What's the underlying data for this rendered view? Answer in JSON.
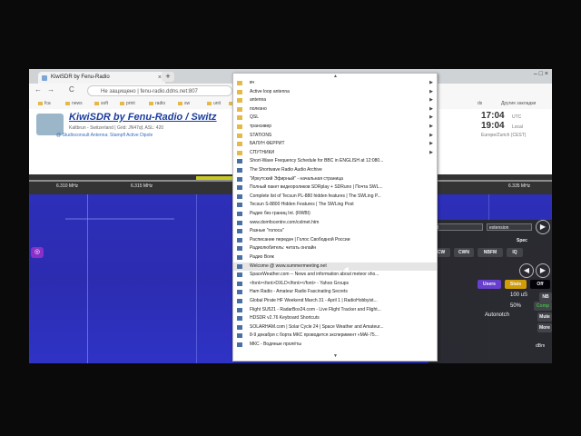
{
  "browser": {
    "tab_title": "KiwiSDR by Fenu-Radio",
    "tab_close": "×",
    "new_tab": "+",
    "window_controls": "–  □  ×",
    "nav": {
      "back": "←",
      "forward": "→",
      "reload": "C",
      "info": "ⓘ"
    },
    "url_security": "Не защищено",
    "url": "fenu-radio.ddns.net:807",
    "bookmarks": [
      "fca",
      "news",
      "soft",
      "print",
      "radio",
      "sw",
      "unit",
      "Sm"
    ],
    "right_bookmark_1": "ds",
    "right_bookmark_2": "Другие закладки"
  },
  "kiwi": {
    "title": "KiwiSDR by Fenu-Radio / Switz",
    "subtitle": "Kaltbrun - Switzerland | Grid: JN47qf, ASL: 420",
    "antenna": "@ Studioconsult    Antenna: Stampfl Active Dipole",
    "utc_time": "17:04",
    "utc_label": "UTC",
    "local_time": "19:04",
    "local_label": "Local",
    "tz": "Europe/Zurich (CEST)"
  },
  "scale": {
    "ticks": [
      "6.310 MHz",
      "6.315 MHz",
      "6.335 MHz"
    ]
  },
  "waterfall": {
    "badge": "◎"
  },
  "controls": {
    "mode_select": "fd",
    "ext_select": "extension",
    "play": "▶",
    "spec": "Spec",
    "modes": [
      "CW",
      "CWN",
      "NBFM",
      "IQ"
    ],
    "users": "Users",
    "stats": "Stats",
    "off": "Off",
    "gain": "100 uS",
    "nb": "NB",
    "pct": "50%",
    "comp": "Comp",
    "autonotch": "Autonotch",
    "mute": "Mute",
    "more": "More",
    "dbm": "dBm",
    "left": "◀",
    "right": "▶"
  },
  "menu": {
    "items": [
      {
        "label": "вч",
        "type": "folder",
        "arrow": "▶"
      },
      {
        "label": "Active loop antenna",
        "type": "folder",
        "arrow": "▶"
      },
      {
        "label": "antenna",
        "type": "folder",
        "arrow": "▶"
      },
      {
        "label": "полезно",
        "type": "folder",
        "arrow": "▶"
      },
      {
        "label": "QSL",
        "type": "folder",
        "arrow": "▶"
      },
      {
        "label": "трансивер",
        "type": "folder",
        "arrow": "▶"
      },
      {
        "label": "STATIONS",
        "type": "folder",
        "arrow": "▶"
      },
      {
        "label": "БАЛУН ФЕРРИТ",
        "type": "folder",
        "arrow": "▶"
      },
      {
        "label": "СПУТНИКИ",
        "type": "folder",
        "arrow": "▶"
      },
      {
        "label": "Short-Wave Frequency Schedule for BBC in ENGLISH at 12:080...",
        "type": "page",
        "arrow": ""
      },
      {
        "label": "The Shortwave Radio Audio Archive",
        "type": "page",
        "arrow": ""
      },
      {
        "label": "\"Иркутский Эфирный\" - начальная страница",
        "type": "page",
        "arrow": ""
      },
      {
        "label": "Полный пакет видеороликов SDRplay + SDRuno | Почта SWL...",
        "type": "page",
        "arrow": ""
      },
      {
        "label": "Complete list of Tecsun PL-880 hidden features | The SWLing P...",
        "type": "page",
        "arrow": ""
      },
      {
        "label": "Tecsun S-8800 Hidden Features | The SWLing Post",
        "type": "page",
        "arrow": ""
      },
      {
        "label": "Радио без границ Int. (RWBI)",
        "type": "page",
        "arrow": ""
      },
      {
        "label": "www.domfocentre.com/colmet.htm",
        "type": "page",
        "arrow": ""
      },
      {
        "label": "Разные \"голоса\"",
        "type": "page",
        "arrow": ""
      },
      {
        "label": "Расписание передач | Голос Свободной России",
        "type": "page",
        "arrow": ""
      },
      {
        "label": "Радиолюбитель: читать онлайн",
        "type": "page",
        "arrow": ""
      },
      {
        "label": "Радио Вояк",
        "type": "page",
        "arrow": ""
      },
      {
        "label": "Welcome @ www.summermeeting.net",
        "type": "page",
        "arrow": ""
      },
      {
        "label": "SpaceWeather.com -- News and information about meteor sho...",
        "type": "page",
        "arrow": ""
      },
      {
        "label": "<font><font>DXLD</font></font> - Yahoo Groups",
        "type": "page",
        "arrow": ""
      },
      {
        "label": "Ham Radio - Amateur Radio Fascinating Secrets",
        "type": "page",
        "arrow": ""
      },
      {
        "label": "Global Pirate HF Weekend March 31 - April 1 | RadioHobbyist...",
        "type": "page",
        "arrow": ""
      },
      {
        "label": "Flight SU521 - RadarBox24.com - Live Flight Tracker and Flight...",
        "type": "page",
        "arrow": ""
      },
      {
        "label": "HDSDR v2.76 Keyboard Shortcuts",
        "type": "page",
        "arrow": ""
      },
      {
        "label": "SOLARHAM.com | Solar Cycle 24 | Space Weather and Amateur...",
        "type": "page",
        "arrow": ""
      },
      {
        "label": "8-9 декабря с борта МКС проводится эксперимент «MAI-75...",
        "type": "page",
        "arrow": ""
      },
      {
        "label": "МКС - Водяные пролёты",
        "type": "page",
        "arrow": ""
      }
    ],
    "scroll_up": "▲",
    "scroll_down": "▼"
  },
  "colors": {
    "waterfall": "#2d2fb9",
    "accent": "#1a3c9c",
    "menu_bg": "#ffffff"
  }
}
